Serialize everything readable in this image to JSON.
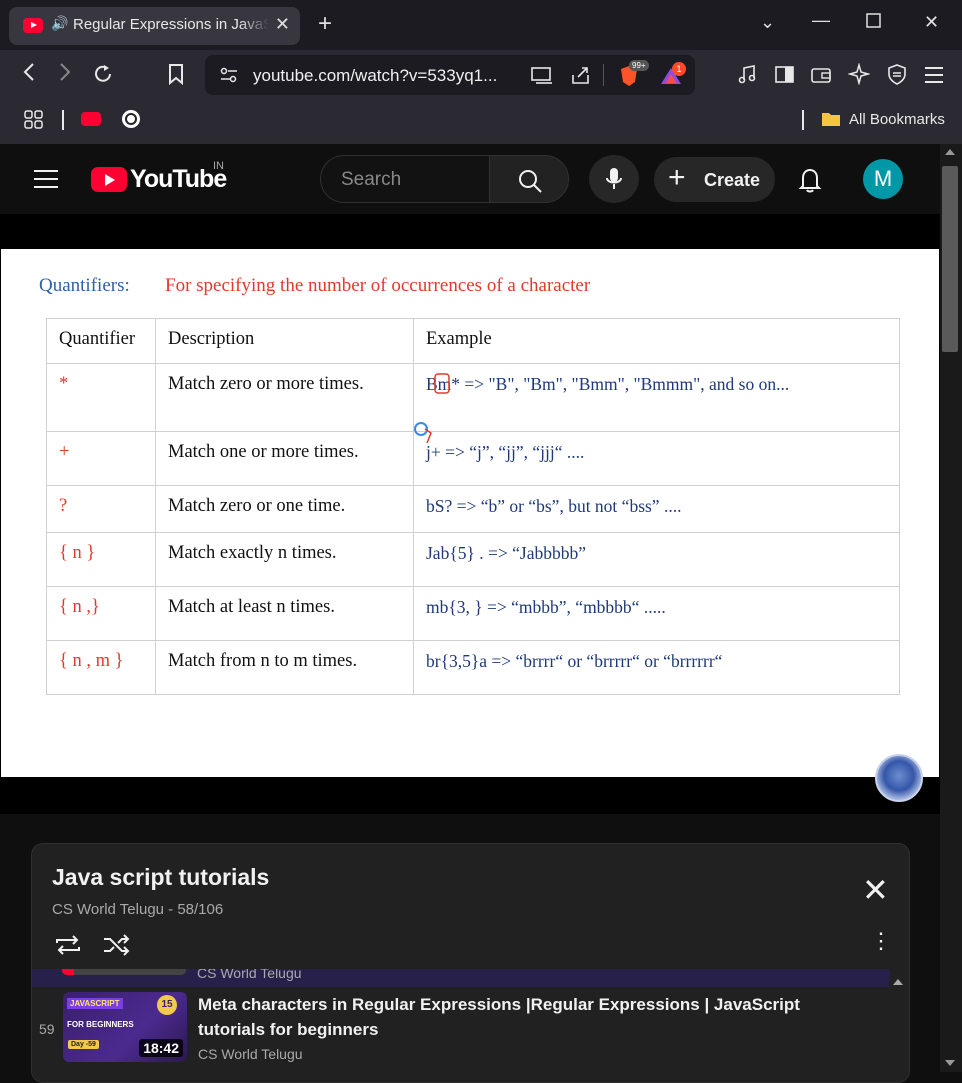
{
  "browser": {
    "tab_title": "Regular Expressions in JavaScript",
    "url": "youtube.com/watch?v=533yq1...",
    "bookmarks_label": "All Bookmarks",
    "shield_badge": "99+",
    "rewards_badge": "1"
  },
  "youtube": {
    "logo_text": "YouTube",
    "country_code": "IN",
    "search_placeholder": "Search",
    "create_label": "Create",
    "avatar_letter": "M"
  },
  "slide": {
    "title": "Quantifiers:",
    "subtitle": "For specifying the number of occurrences of a character",
    "headers": [
      "Quantifier",
      "Description",
      "Example"
    ],
    "rows": [
      {
        "q": "*",
        "desc": "Match zero or more times.",
        "ex": "Bm* => \"B\", \"Bm\", \"Bmm\", \"Bmmm\", and so on..."
      },
      {
        "q": "+",
        "desc": "Match one or more times.",
        "ex": "j+  =>  “j”, “jj”, “jjj“ ...."
      },
      {
        "q": "?",
        "desc": "Match zero or one time.",
        "ex": "bS?  =>  “b” or “bs”, but not “bss” ...."
      },
      {
        "q": "{ n }",
        "desc": "Match exactly n times.",
        "ex": "Jab{5} . => “Jabbbbb”"
      },
      {
        "q": "{ n ,}",
        "desc": "Match at least n times.",
        "ex": "mb{3, } => “mbbb”, “mbbbb“ ....."
      },
      {
        "q": "{ n , m }",
        "desc": "Match from n to m times.",
        "ex": "br{3,5}a => “brrrr“ or “brrrrr“ or “brrrrrr“"
      }
    ]
  },
  "playlist": {
    "title": "Java script tutorials",
    "subtitle": "CS World Telugu - 58/106",
    "prev_channel": "CS World Telugu",
    "item": {
      "index": "59",
      "title": "Meta characters in Regular Expressions |Regular Expressions | JavaScript tutorials for beginners",
      "channel": "CS World Telugu",
      "duration": "18:42",
      "thumb_tag": "JAVASCRIPT",
      "thumb_line": "FOR BEGINNERS",
      "thumb_day": "Day -59",
      "thumb_num": "15"
    }
  },
  "colors": {
    "accent_red": "#ff0033",
    "slide_blue": "#2e5fa8",
    "slide_red": "#e23a2a",
    "avatar": "#0097a7"
  }
}
